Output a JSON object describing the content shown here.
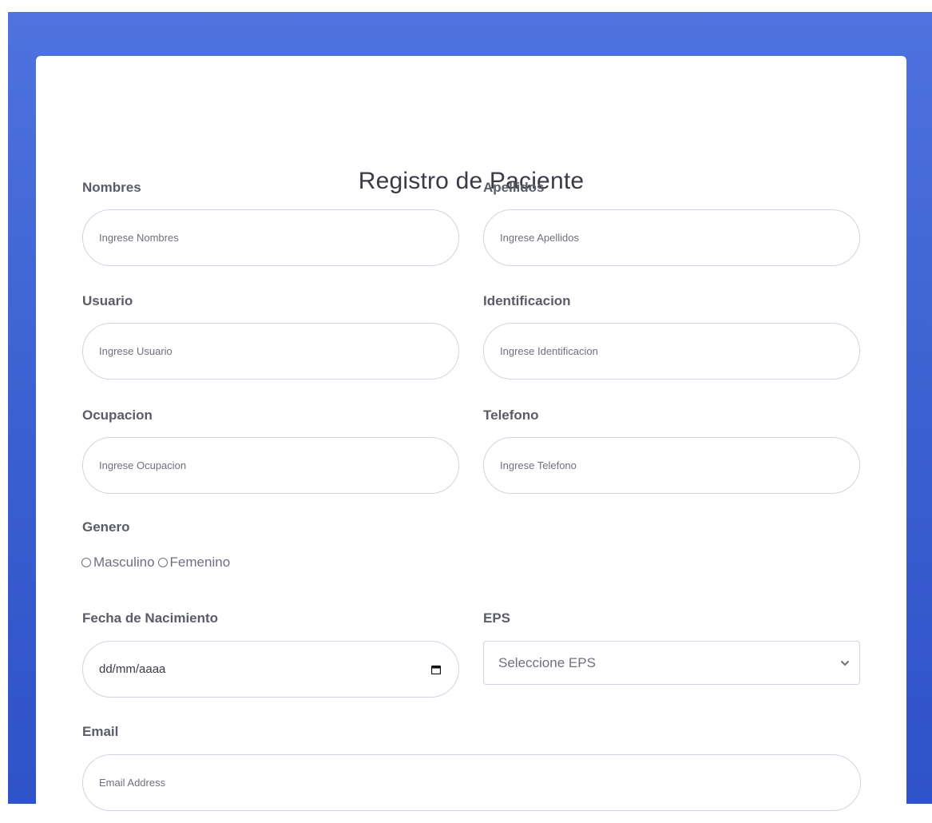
{
  "form": {
    "title": "Registro de Paciente",
    "nombres": {
      "label": "Nombres",
      "placeholder": "Ingrese Nombres"
    },
    "apellidos": {
      "label": "Apellidos",
      "placeholder": "Ingrese Apellidos"
    },
    "usuario": {
      "label": "Usuario",
      "placeholder": "Ingrese Usuario"
    },
    "identificacion": {
      "label": "Identificacion",
      "placeholder": "Ingrese Identificacion"
    },
    "ocupacion": {
      "label": "Ocupacion",
      "placeholder": "Ingrese Ocupacion"
    },
    "telefono": {
      "label": "Telefono",
      "placeholder": "Ingrese Telefono"
    },
    "genero": {
      "label": "Genero",
      "options": [
        "Masculino",
        "Femenino"
      ]
    },
    "fecha": {
      "label": "Fecha de Nacimiento",
      "value": "dd/mm/aaaa",
      "icon": "calendar-icon"
    },
    "eps": {
      "label": "EPS",
      "selected": "Seleccione EPS",
      "icon": "chevron-down-icon"
    },
    "email": {
      "label": "Email",
      "placeholder": "Email Address"
    }
  },
  "colors": {
    "background": "#4e73df",
    "card": "#ffffff",
    "label": "#5a5c69",
    "input_border": "#d1d3e2"
  }
}
